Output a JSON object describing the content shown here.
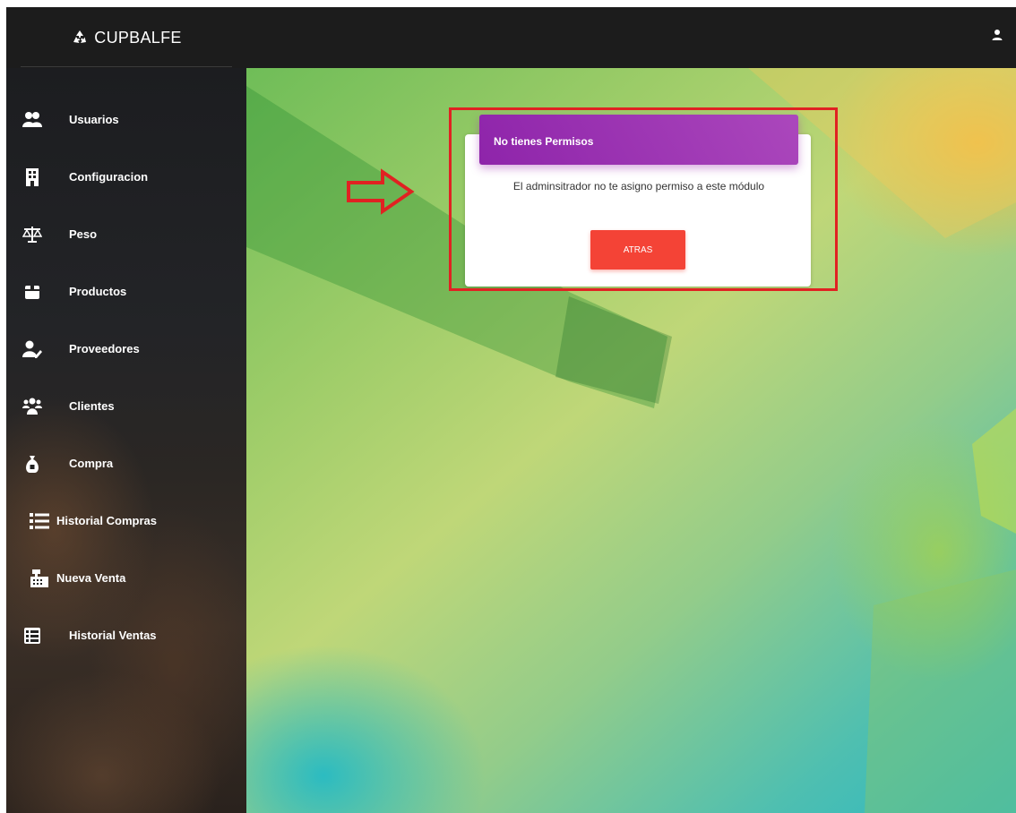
{
  "header": {
    "brand": "CUPBALFE",
    "brand_icon": "recycle-icon",
    "user_icon": "user-icon",
    "background": "#1c1c1c"
  },
  "sidebar": {
    "items": [
      {
        "label": "Usuarios",
        "icon": "users-icon"
      },
      {
        "label": "Configuracion",
        "icon": "building-icon"
      },
      {
        "label": "Peso",
        "icon": "scale-icon"
      },
      {
        "label": "Productos",
        "icon": "box-icon"
      },
      {
        "label": "Proveedores",
        "icon": "user-edit-icon"
      },
      {
        "label": "Clientes",
        "icon": "users-group-icon"
      },
      {
        "label": "Compra",
        "icon": "money-bag-icon"
      },
      {
        "label": "Historial Compras",
        "icon": "list-icon"
      },
      {
        "label": "Nueva Venta",
        "icon": "cash-register-icon"
      },
      {
        "label": "Historial Ventas",
        "icon": "table-icon"
      }
    ]
  },
  "modal": {
    "title": "No tienes Permisos",
    "message": "El adminsitrador no te asigno permiso a este módulo",
    "button_label": "ATRAS",
    "header_color": "#9c27b0",
    "button_color": "#f44336"
  },
  "annotation": {
    "highlight_color": "#e02222",
    "arrow_icon": "right-arrow-icon"
  }
}
